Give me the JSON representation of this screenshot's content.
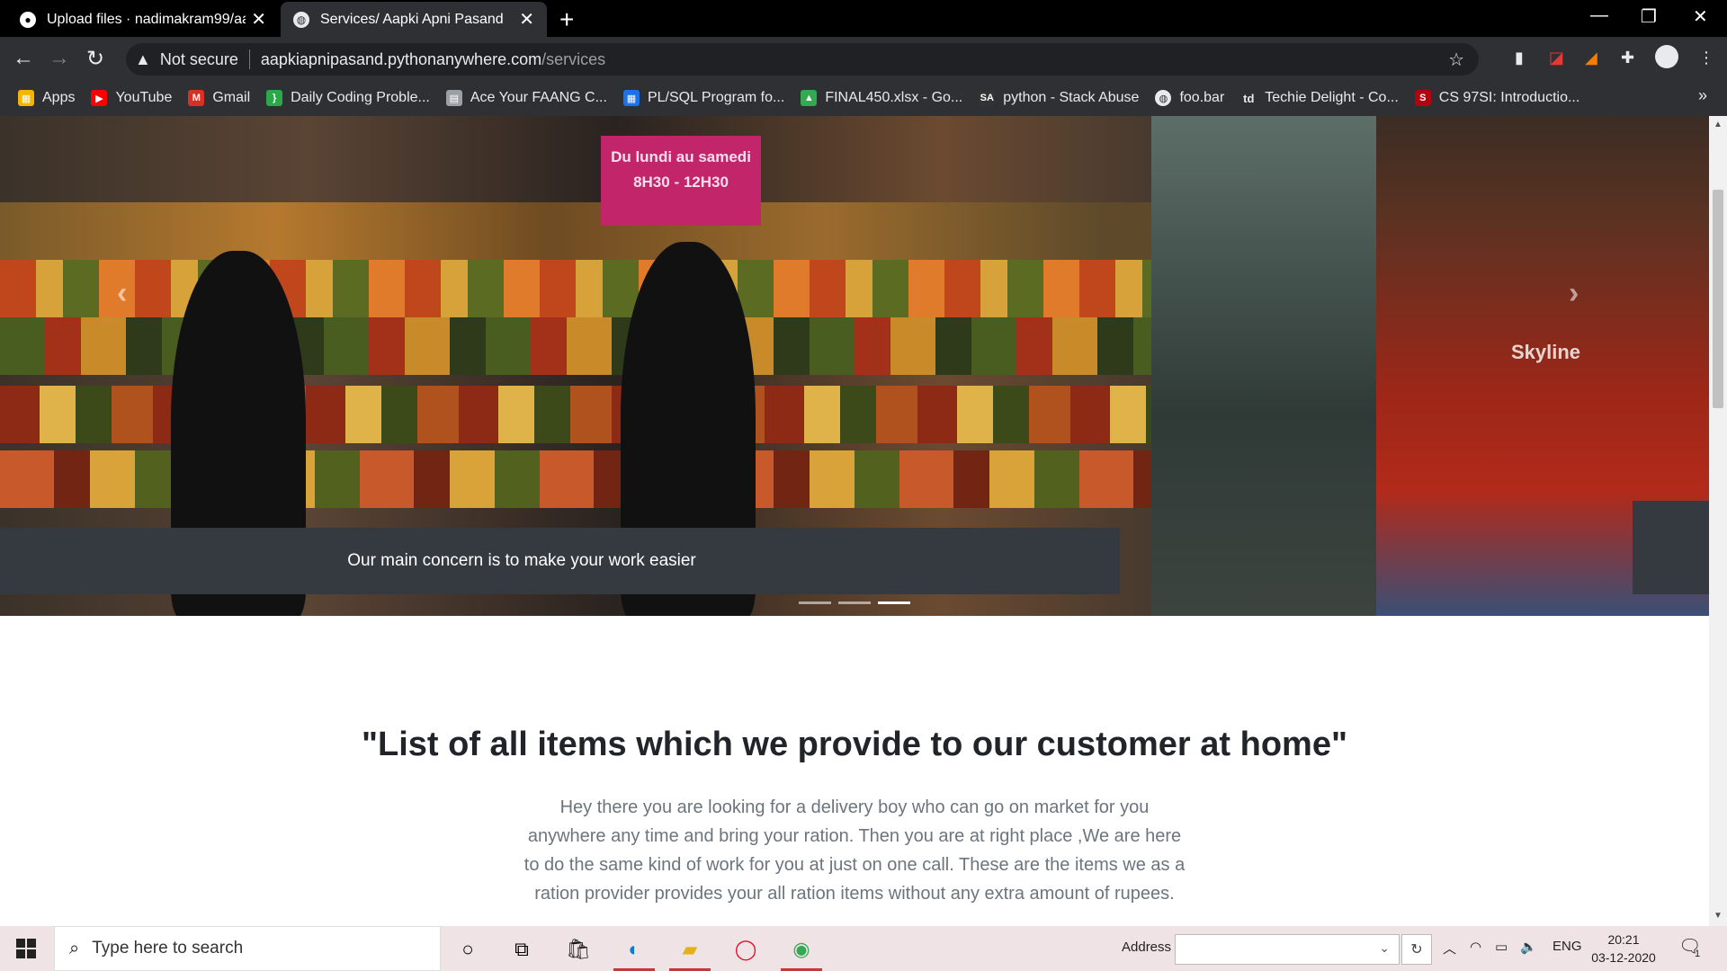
{
  "browser": {
    "tabs": [
      {
        "title": "Upload files · nadimakram99/aap",
        "active": false,
        "favicon": "github-icon"
      },
      {
        "title": "Services/ Aapki Apni Pasand",
        "active": true,
        "favicon": "globe-icon"
      }
    ],
    "new_tab_label": "+",
    "address": {
      "security": "Not secure",
      "host": "aapkiapnipasand.pythonanywhere.com",
      "path": "/services"
    },
    "bookmarks": [
      {
        "label": "Apps",
        "icon": "apps-grid-icon",
        "color": "#f4b400"
      },
      {
        "label": "YouTube",
        "icon": "youtube-icon",
        "color": "#ff0000"
      },
      {
        "label": "Gmail",
        "icon": "gmail-icon",
        "color": "#d93025"
      },
      {
        "label": "Daily Coding Proble...",
        "icon": "daily-coding-icon",
        "color": "#2ba84a"
      },
      {
        "label": "Ace Your FAANG C...",
        "icon": "document-icon",
        "color": "#9aa0a6"
      },
      {
        "label": "PL/SQL Program fo...",
        "icon": "grid-icon",
        "color": "#1a73e8"
      },
      {
        "label": "FINAL450.xlsx - Go...",
        "icon": "google-drive-icon",
        "color": "#34a853"
      },
      {
        "label": "python - Stack Abuse",
        "icon": "stack-abuse-icon",
        "color": "#333333"
      },
      {
        "label": "foo.bar",
        "icon": "foobar-icon",
        "color": "#e8eaed"
      },
      {
        "label": "Techie Delight - Co...",
        "icon": "techie-delight-icon",
        "color": "#2f3033"
      },
      {
        "label": "CS 97SI: Introductio...",
        "icon": "stanford-icon",
        "color": "#b1040e"
      }
    ]
  },
  "page": {
    "carousel": {
      "caption": "Our main concern is to make your work easier",
      "indicators": 3,
      "active_indicator": 3,
      "sign_text": "Du lundi au samedi 8H30 - 12H30",
      "store_label": "Skyline"
    },
    "heading": "\"List of all items which we provide to our customer at home\"",
    "lead": "Hey there you are looking for a delivery boy who can go on market for you anywhere any time and bring your ration. Then you are at right place ,We are here to do the same kind of work for you at just on one call. These are the items we as a ration provider provides your all ration items without any extra amount of rupees."
  },
  "taskbar": {
    "search_placeholder": "Type here to search",
    "address_label": "Address",
    "language": "ENG",
    "time": "20:21",
    "date": "03-12-2020",
    "notification_count": "1"
  }
}
